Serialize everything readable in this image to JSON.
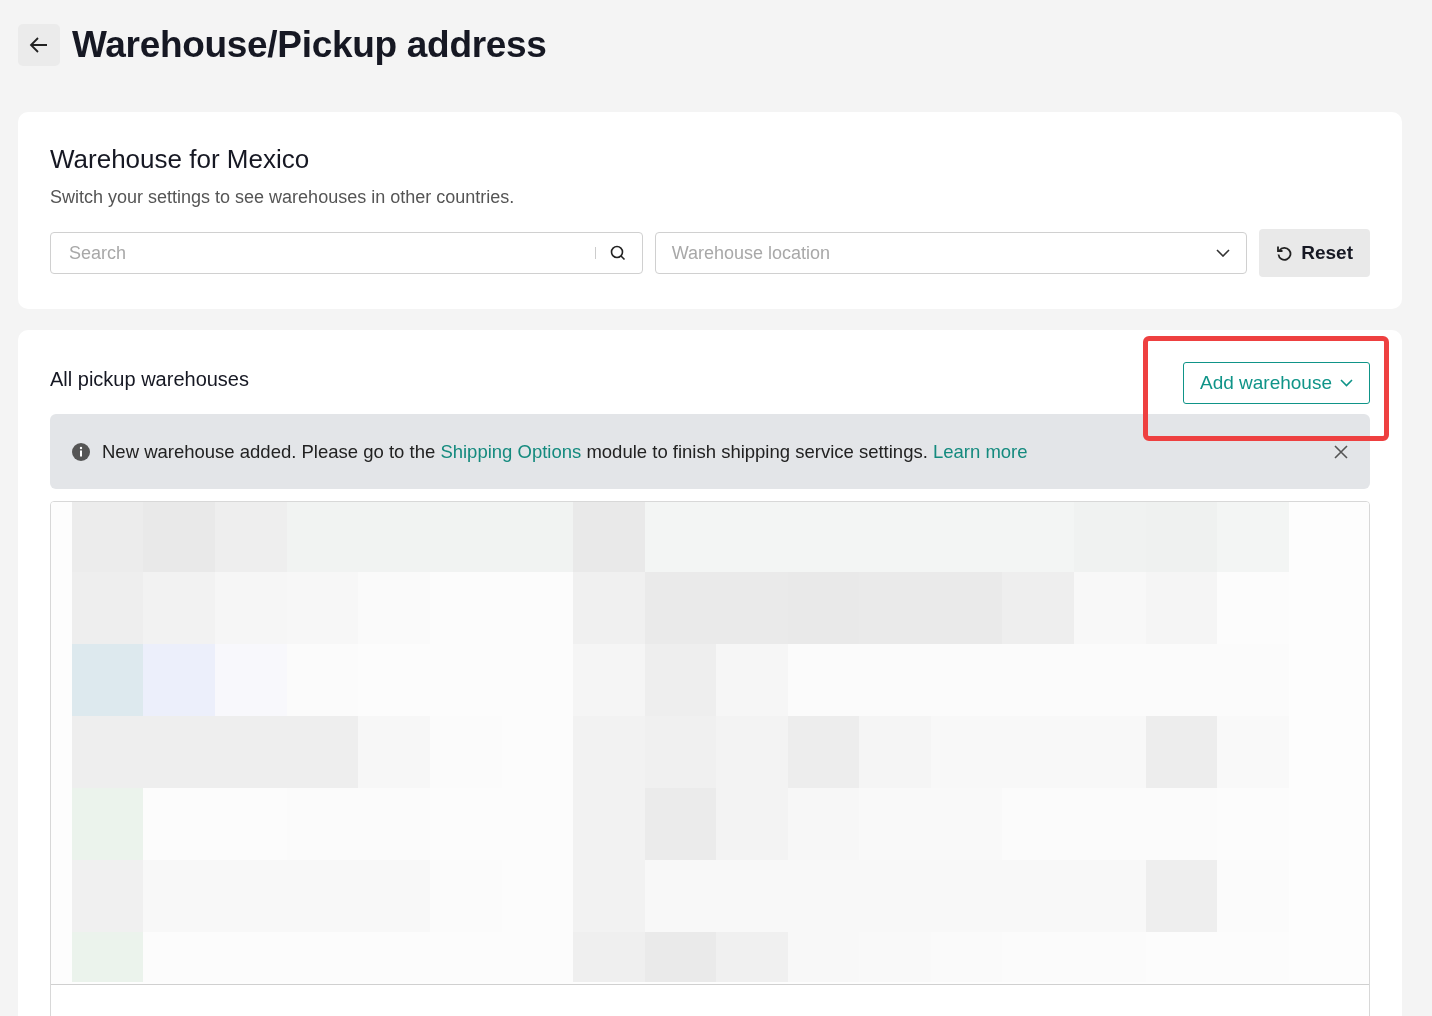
{
  "header": {
    "title": "Warehouse/Pickup address"
  },
  "filter_card": {
    "title": "Warehouse for Mexico",
    "subtitle": "Switch your settings to see warehouses in other countries.",
    "search": {
      "placeholder": "Search"
    },
    "location_select": {
      "placeholder": "Warehouse location"
    },
    "reset_button": "Reset"
  },
  "warehouses_card": {
    "title": "All pickup warehouses",
    "add_button": {
      "label": "Add warehouse",
      "highlighted": true
    },
    "notice": {
      "text_before": "New warehouse added. Please go to the ",
      "link": "Shipping Options",
      "text_after": " module to finish shipping service settings. ",
      "learn_more": "Learn more"
    }
  }
}
